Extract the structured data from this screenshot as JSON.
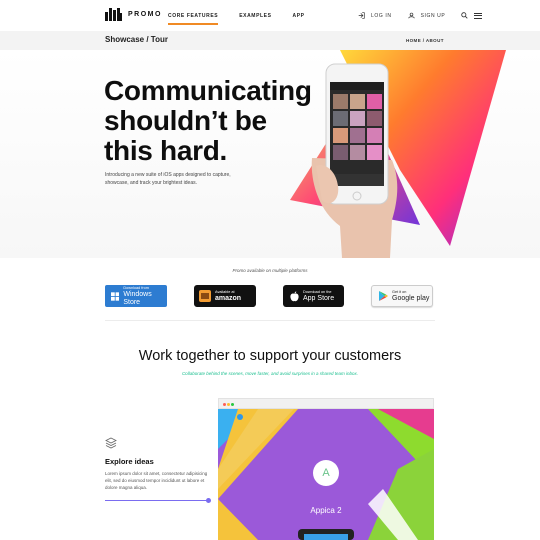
{
  "brand": {
    "name": "PROMO"
  },
  "nav": {
    "links": [
      {
        "label": "CORE FEATURES",
        "active": true
      },
      {
        "label": "EXAMPLES",
        "active": false
      },
      {
        "label": "APP",
        "active": false
      }
    ],
    "login": "LOG IN",
    "signup": "SIGN UP",
    "icons": [
      "login-icon",
      "signup-icon",
      "search-icon",
      "menu-icon"
    ]
  },
  "breadcrumb": {
    "title": "Showcase / Tour",
    "trail": "HOME / ABOUT"
  },
  "hero": {
    "title_lines": [
      "Communicating",
      "shouldn’t be",
      "this hard."
    ],
    "subtitle": "Introducing a new suite of iOS apps designed to capture, showcase, and track your brightest ideas."
  },
  "platforms": {
    "label": "Promo available on multiple platforms",
    "stores": [
      {
        "small": "Download from",
        "big": "Windows Store"
      },
      {
        "small": "Available at",
        "big": "amazon"
      },
      {
        "small": "Download on the",
        "big": "App Store"
      },
      {
        "small": "Get it on",
        "big": "Google play"
      }
    ]
  },
  "section": {
    "title": "Work together to support your customers",
    "subtitle": "Collaborate behind the scenes, move faster, and avoid surprises in a shared team inbox."
  },
  "feature": {
    "title": "Explore ideas",
    "text": "Lorem ipsum dolor sit amet, consectetur adipisicing elit, sed do eiusmod tempor incididunt ut labore et dolore magna aliqua."
  },
  "preview": {
    "app_name": "Appica 2",
    "avatar_letter": "A"
  },
  "colors": {
    "accent_orange": "#f08a24",
    "store_windows": "#2d7cd1",
    "subtitle_green": "#1bbf8f",
    "feature_line": "#7a6cf0"
  }
}
